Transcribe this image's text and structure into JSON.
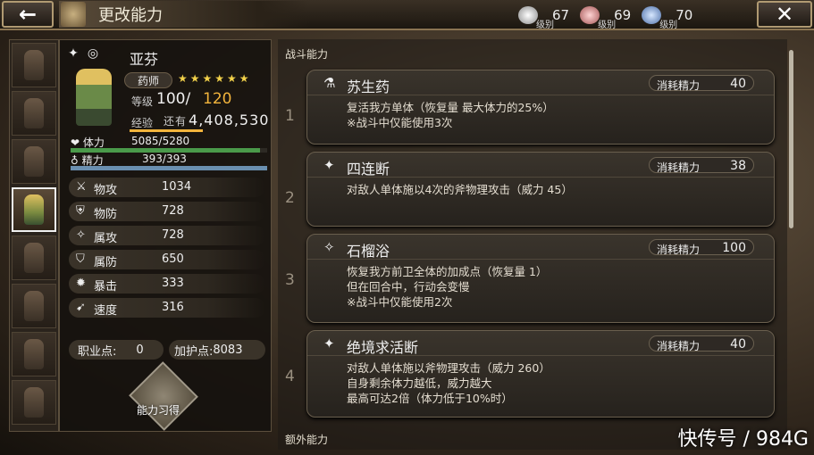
{
  "header": {
    "title": "更改能力",
    "back_icon": "←",
    "close_icon": "✕"
  },
  "tiers": [
    {
      "label": "级别",
      "value": "67",
      "color": "#e0e0e0"
    },
    {
      "label": "级别",
      "value": "69",
      "color": "#d87a7a"
    },
    {
      "label": "级别",
      "value": "70",
      "color": "#7a9ad8"
    }
  ],
  "character": {
    "name": "亚芬",
    "job": "药师",
    "stars": "★★★★★★",
    "level_label": "等级",
    "level": "100/",
    "level_max": "120",
    "exp_label": "经验",
    "exp_remaining_label": "还有",
    "exp_value": "4,408,530",
    "hp_label": "体力",
    "hp": "5085/5280",
    "hp_fill": 0.963,
    "mp_label": "精力",
    "mp": "393/393",
    "mp_fill": 1.0
  },
  "stats": [
    {
      "icon": "sword-icon",
      "label": "物攻",
      "value": "1034"
    },
    {
      "icon": "shield-icon",
      "label": "物防",
      "value": "728"
    },
    {
      "icon": "magic-attack-icon",
      "label": "属攻",
      "value": "728"
    },
    {
      "icon": "magic-defense-icon",
      "label": "属防",
      "value": "650"
    },
    {
      "icon": "critical-icon",
      "label": "暴击",
      "value": "333"
    },
    {
      "icon": "boot-icon",
      "label": "速度",
      "value": "316"
    }
  ],
  "points": {
    "job_label": "职业点:",
    "job_value": "0",
    "jp_label": "加护点:",
    "jp_value": "8083"
  },
  "learn_button": "能力习得",
  "sections": {
    "battle": "战斗能力",
    "extra": "额外能力"
  },
  "abilities": [
    {
      "num": "1",
      "icon": "⚗",
      "name": "苏生药",
      "cost_label": "消耗精力",
      "cost": "40",
      "lines": [
        "复活我方单体（恢复量 最大体力的25%）",
        "※战斗中仅能使用3次"
      ]
    },
    {
      "num": "2",
      "icon": "✦",
      "name": "四连断",
      "cost_label": "消耗精力",
      "cost": "38",
      "lines": [
        "对敌人单体施以4次的斧物理攻击（威力 45）"
      ]
    },
    {
      "num": "3",
      "icon": "✧",
      "name": "石榴浴",
      "cost_label": "消耗精力",
      "cost": "100",
      "lines": [
        "恢复我方前卫全体的加成点（恢复量 1）",
        "但在回合中，行动会变慢",
        "※战斗中仅能使用2次"
      ]
    },
    {
      "num": "4",
      "icon": "✦",
      "name": "绝境求活断",
      "cost_label": "消耗精力",
      "cost": "40",
      "lines": [
        "对敌人单体施以斧物理攻击（威力 260）",
        "自身剩余体力越低，威力越大",
        "最高可达2倍（体力低于10%时）"
      ]
    }
  ],
  "watermark": "快传号 / 984G"
}
